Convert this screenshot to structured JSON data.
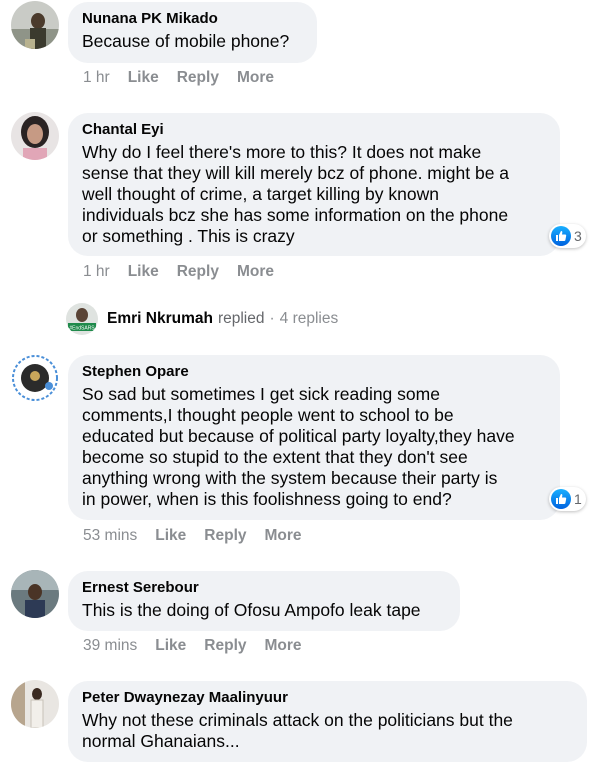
{
  "colors": {
    "bubble": "#f0f2f5",
    "meta_text": "#8a8d91",
    "like_blue": "#1877f2"
  },
  "comments": [
    {
      "author": "Nunana PK Mikado",
      "text": "Because of mobile phone?",
      "time": "1 hr",
      "actions": [
        "Like",
        "Reply",
        "More"
      ]
    },
    {
      "author": "Chantal Eyi",
      "text_lines": [
        "Why do I feel there's more to this? It does not make",
        "sense that they will kill merely bcz of phone. might be a",
        "well thought of crime, a target killing by known",
        "individuals bcz she has some information on the phone",
        "or something . This is crazy"
      ],
      "time": "1 hr",
      "actions": [
        "Like",
        "Reply",
        "More"
      ],
      "reaction_icon": "thumbs-up-icon",
      "reaction_count": "3"
    },
    {
      "author": "Stephen Opare",
      "text_lines": [
        "So sad but sometimes I get sick reading some",
        "comments,I thought people went to school to be",
        "educated but because of political party loyalty,they have",
        "become so stupid to the extent that they don't see",
        "anything wrong with the system because their party is",
        "in power, when is this foolishness going to end?"
      ],
      "time": "53 mins",
      "actions": [
        "Like",
        "Reply",
        "More"
      ],
      "reaction_icon": "thumbs-up-icon",
      "reaction_count": "1"
    },
    {
      "author": "Ernest Serebour",
      "text": "This is the doing of Ofosu Ampofo leak tape",
      "time": "39 mins",
      "actions": [
        "Like",
        "Reply",
        "More"
      ]
    },
    {
      "author": "Peter Dwaynezay Maalinyuur",
      "text_lines": [
        "Why not these criminals attack on the politicians but the",
        "normal Ghanaians..."
      ]
    }
  ],
  "replies_preview": {
    "name": "Emri Nkrumah",
    "verb": "replied",
    "separator": "·",
    "count": "4 replies",
    "avatar_badge": "#EndSARS"
  }
}
